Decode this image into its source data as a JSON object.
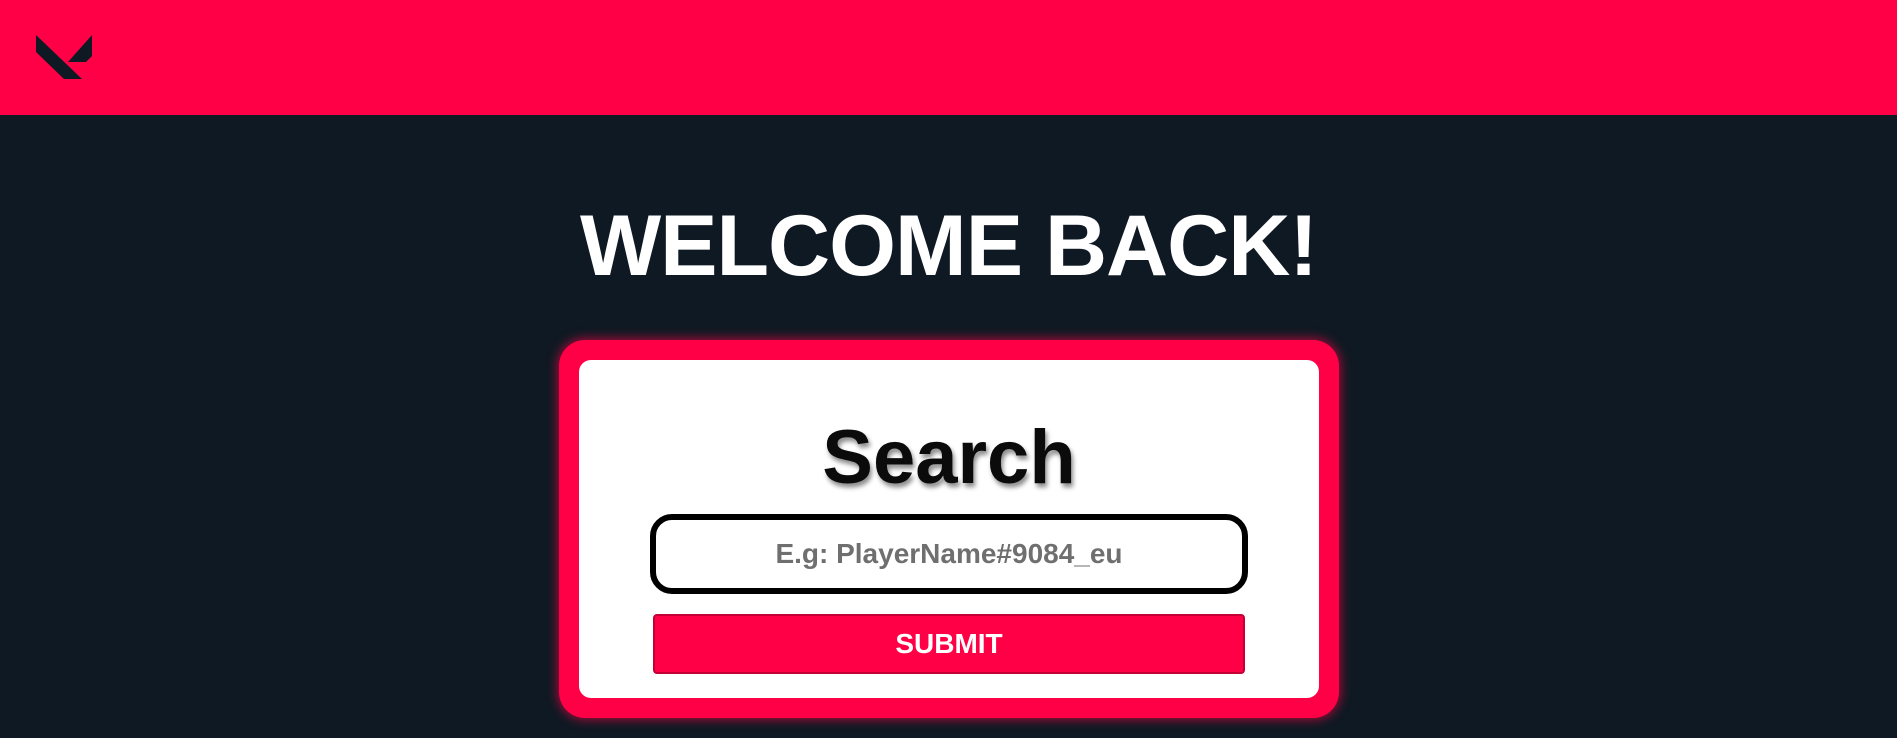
{
  "header": {
    "logo_icon": "valorant-logo-icon",
    "background_color": "#ff0046"
  },
  "main": {
    "welcome_text": "WELCOME BACK!",
    "background_color": "#0f1923"
  },
  "search_card": {
    "title": "Search",
    "input_value": "",
    "input_placeholder": "E.g: PlayerName#9084_eu",
    "submit_label": "SUBMIT",
    "accent_color": "#ff0046"
  }
}
